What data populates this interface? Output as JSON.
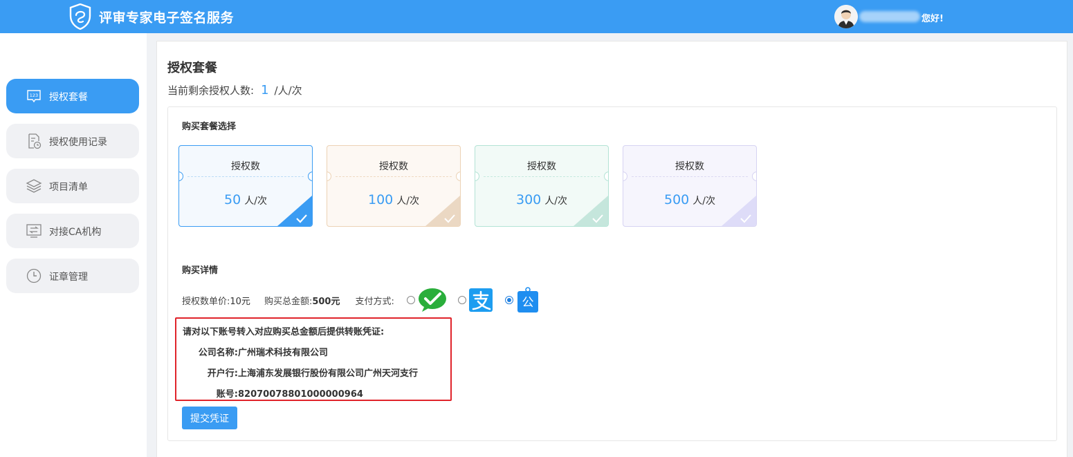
{
  "header": {
    "app_title": "评审专家电子签名服务",
    "greeting": "您好!"
  },
  "sidebar": {
    "items": [
      {
        "label": "授权套餐",
        "icon": "badge-123-icon",
        "active": true
      },
      {
        "label": "授权使用记录",
        "icon": "document-clock-icon",
        "active": false
      },
      {
        "label": "项目清单",
        "icon": "layers-icon",
        "active": false
      },
      {
        "label": "对接CA机构",
        "icon": "transfer-icon",
        "active": false
      },
      {
        "label": "证章管理",
        "icon": "clock-icon",
        "active": false
      }
    ]
  },
  "main": {
    "title": "授权套餐",
    "remaining_label": "当前剩余授权人数:",
    "remaining_count": "1",
    "remaining_unit": "/人/次",
    "package_section_title": "购买套餐选择",
    "packages": [
      {
        "label": "授权数",
        "amount": "50",
        "unit": "人/次",
        "selected": true,
        "color": "#3a9cf3"
      },
      {
        "label": "授权数",
        "amount": "100",
        "unit": "人/次",
        "selected": false,
        "color": "#e8c9a6"
      },
      {
        "label": "授权数",
        "amount": "300",
        "unit": "人/次",
        "selected": false,
        "color": "#a6dfcf"
      },
      {
        "label": "授权数",
        "amount": "500",
        "unit": "人/次",
        "selected": false,
        "color": "#cfcdf2"
      }
    ],
    "detail_section_title": "购买详情",
    "unit_price_label": "授权数单价:",
    "unit_price": "10元",
    "total_label": "购买总金额:",
    "total": "500元",
    "payment_label": "支付方式:",
    "payment_methods": [
      {
        "icon": "wechat-pay-icon",
        "selected": false
      },
      {
        "icon": "alipay-icon",
        "selected": false
      },
      {
        "icon": "corporate-transfer-icon",
        "glyph": "公",
        "selected": true
      }
    ],
    "transfer_info": {
      "instruction": "请对以下账号转入对应购买总金额后提供转账凭证:",
      "company_label": "公司名称:",
      "company": "广州瑞术科技有限公司",
      "bank_label": "开户行:",
      "bank": "上海浦东发展银行股份有限公司广州天河支行",
      "account_label": "账号:",
      "account": "82070078801000000964"
    },
    "submit_label": "提交凭证"
  },
  "colors": {
    "accent": "#3a9cf3",
    "highlight_border": "#e0232a",
    "wechat": "#2aae3b",
    "alipay": "#1d9df0"
  }
}
